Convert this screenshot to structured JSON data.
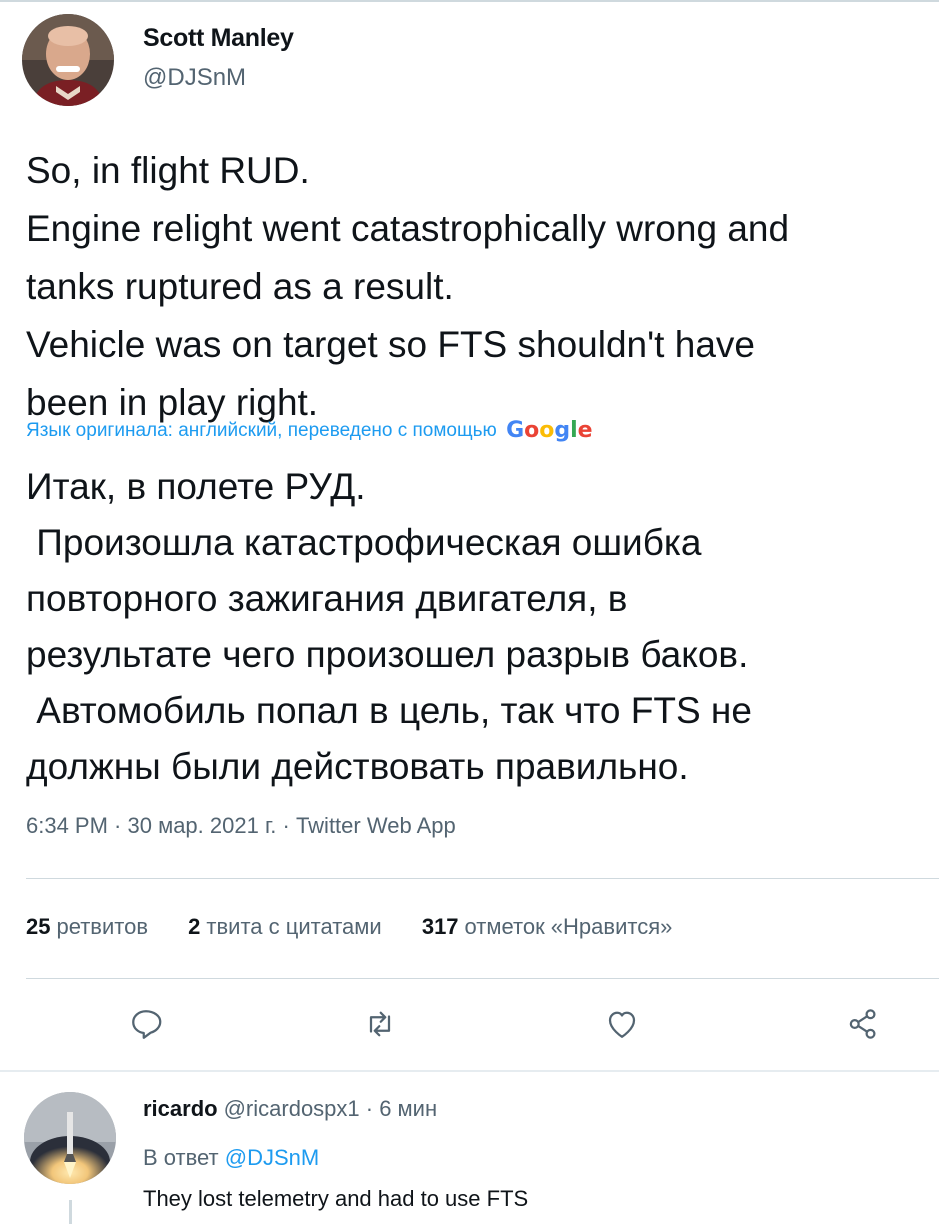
{
  "tweet": {
    "author_name": "Scott Manley",
    "author_handle": "@DJSnM",
    "text_lines": [
      "So, in flight RUD.",
      "Engine relight went catastrophically wrong and",
      "tanks ruptured as a result.",
      "Vehicle was on target so FTS shouldn't have",
      "been in play right."
    ],
    "translation_note": "Язык оригинала: английский, переведено с помощью",
    "translation_provider": "Google",
    "translated_lines": [
      "Итак, в полете РУД.",
      " Произошла катастрофическая ошибка",
      "повторного зажигания двигателя, в",
      "результате чего произошел разрыв баков.",
      " Автомобиль попал в цель, так что FTS не",
      "должны были действовать правильно."
    ],
    "timestamp": "6:34 PM · 30 мар. 2021 г. · Twitter Web App"
  },
  "stats": {
    "retweets_count": "25",
    "retweets_label": "ретвитов",
    "quotes_count": "2",
    "quotes_label": "твита с цитатами",
    "likes_count": "317",
    "likes_label": "отметок «Нравится»"
  },
  "actions": {
    "icons": [
      "reply-icon",
      "retweet-icon",
      "like-icon",
      "share-icon"
    ]
  },
  "reply": {
    "name": "ricardo",
    "handle": "@ricardospx1",
    "time": " · 6 мин",
    "reply_to_prefix": "В ответ ",
    "reply_to_handle": "@DJSnM",
    "text": "They lost telemetry and had to use FTS"
  },
  "colors": {
    "accent": "#1d9bf0",
    "secondary_text": "#536471",
    "primary_text": "#0f1419",
    "divider": "#cfd9de"
  }
}
